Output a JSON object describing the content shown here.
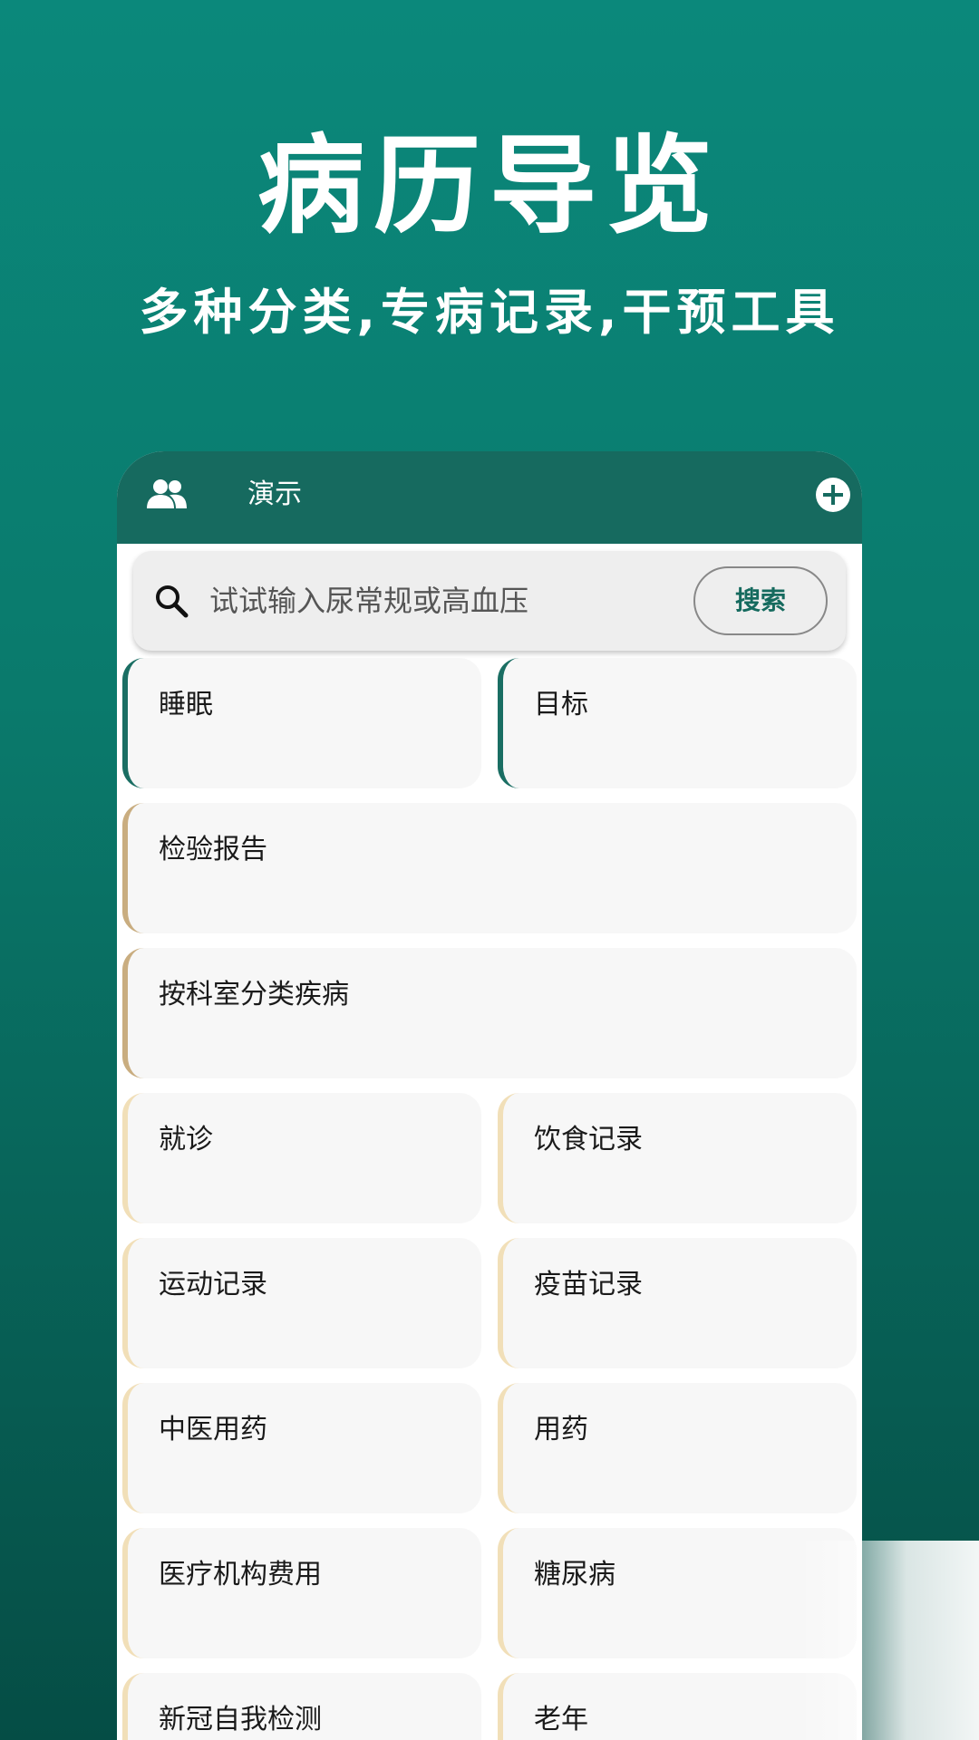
{
  "promo": {
    "headline": "病历导览",
    "subline": "多种分类,专病记录,干预工具"
  },
  "appbar": {
    "profile_name": "演示",
    "left_icon": "people-icon",
    "right_icon": "add-circle-icon"
  },
  "search": {
    "placeholder": "试试输入尿常规或高血压",
    "button_label": "搜索",
    "icon": "search-icon"
  },
  "tiles": [
    {
      "label": "睡眠",
      "accent": "#1a6e63"
    },
    {
      "label": "目标",
      "accent": "#1a6e63"
    },
    {
      "label": "检验报告",
      "accent": "#c9ad80"
    },
    {
      "label": "按科室分类疾病",
      "accent": "#c9ad80"
    },
    {
      "label": "就诊",
      "accent": "#f1dfb8"
    },
    {
      "label": "饮食记录",
      "accent": "#f1dfb8"
    },
    {
      "label": "运动记录",
      "accent": "#f1dfb8"
    },
    {
      "label": "疫苗记录",
      "accent": "#f1dfb8"
    },
    {
      "label": "中医用药",
      "accent": "#f1dfb8"
    },
    {
      "label": "用药",
      "accent": "#f1dfb8"
    },
    {
      "label": "医疗机构费用",
      "accent": "#f1dfb8"
    },
    {
      "label": "糖尿病",
      "accent": "#f1dfb8"
    },
    {
      "label": "新冠自我检测",
      "accent": "#f1dfb8"
    },
    {
      "label": "老年",
      "accent": "#f1dfb8"
    }
  ],
  "colors": {
    "primary": "#166a5f",
    "background_top": "#0b887b",
    "background_bottom": "#054d45"
  }
}
